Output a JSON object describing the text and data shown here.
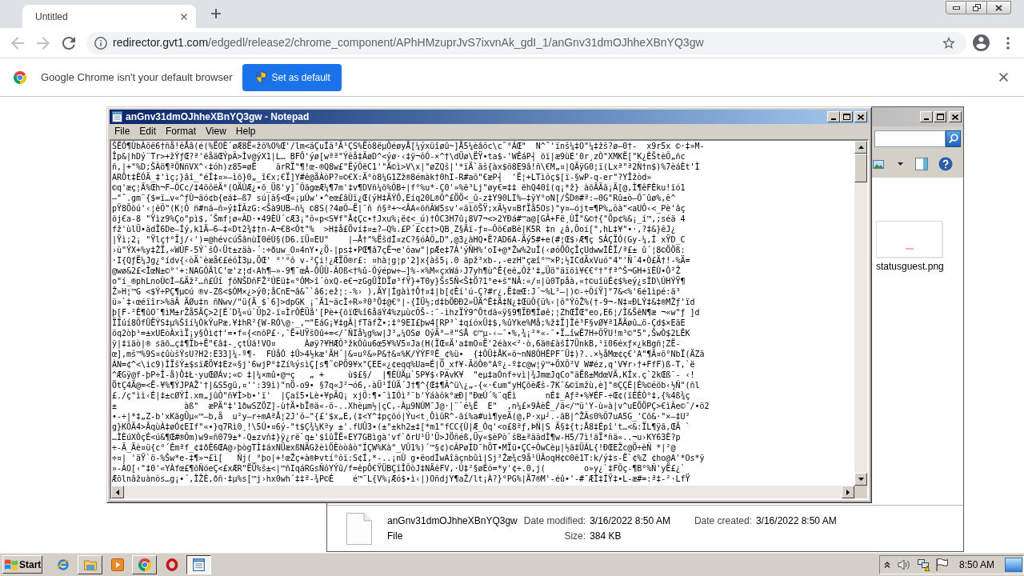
{
  "browser": {
    "tabs": [
      {
        "title": "Untitled",
        "selected": true
      }
    ],
    "toolbar": {
      "back": {
        "disabled": true
      },
      "forward": {
        "disabled": true
      },
      "url": {
        "host": "redirector.gvt1.com",
        "path": "/edgedl/release2/chrome_component/APhHMzuprJvS7ixvnAk_gdI_1/anGnv31dmOJhheXBnYQ3gw"
      }
    },
    "infobar": {
      "message": "Google Chrome isn't your default browser",
      "button": "Set as default"
    }
  },
  "notepad": {
    "title": "anGnv31dmOJhheXBnYQ3gw - Notepad",
    "menu": [
      "File",
      "Edit",
      "Format",
      "View",
      "Help"
    ],
    "lines": [
      "ŠËÓ¶ÙbÀöë6†ñå!êÅâ(é(%ËOÈ´øÆ8Ë«žõ%O%Œ'/lm<äÇuÍã³Ä¹ÇS%Ëò8ëµÒéøyÅ[¼ýxüîøû~]Å5¼èâôc\\c˜°ÁŒ\"  N^ˆ'ïnš¼‡O\"¼‡žš?ø–0†-  x9r5x ©·‡»M-",
      "Îp&|hDý¨Tr>+žÝƒŒ?ª'ëåäŒÝpÃ>Ìv@ýX1|L… BFÔ'ýø[wªª\"Ýêå‡ÄøD^<ýø·‹‡ÿ¬ôÓ-×^†\\dÜø\\ËŸ•ta$-'WÊáP┤ öï|æ9ùE'0r¸zÒ\"XMKË[\"K¿ÈŠtèÕ„ñc",
      "ñ,|+\"%D;ŠÃö¶ªÕNñVX^‹‡óh)z85=øË    ãrRÏ\"¶!œ-®Q8w£\"ËýÕëC1'\"Ä©ì>V\\x|\"øZQš|'*ïÄ`ãš{àx$ö8E9â!ñ\\€M„¤|QÄÿG0¦ï(Lxª\"ª2Ñ†n$)%7èáÈt'Ì",
      "ARÔt‡ÈÓÄ_‡'ìç;}âî_\"éÍ‡¤»–ìõ}0„_î€x;€Ï]Y#ê@åÀòP?¤©€X:Ä°ò8¼G1Zž®8émàk†0hI-R#aõ\"€æP┤  'Ë¦+LTìôç$[ï-§wP-q-er\"?YÎžòd»",
      "©q'æç¦Ä%Œh¬F—ÕCc/‡4öôëÄ°(OÄÙÆ¿•õ_Üß'y]˜ÕägœÆ¼¶7m'‡v¶DVñ¼õ%ÕB÷|f°%u*-Ç0'»%ë³Lj\"øy€=‡‡ ëhQ40î(q¡*ž} àöÄÄã¡Ä[@‚Ì¶êFÈku!ïó1",
      "–\"ˆ.gm¨{$=ï…v«^ƒÙ¬äó¢b{eá‡–ß7 sú|ã§<Œ«¡µÚw'•^eœ£âÙï¿Œ(ýH‡ÄÝÔ,Eíq20L®Õ^£ÖÖ<_û-z‡Y90LI%–‡ÿY°oN[/ŠD®#ª:–0G\"Rû±ò–Õ¯ûø%,ê^",
      "pŸ8Öõú'‹¦êÕ\"(K¦Ó ñ#ná–ñ»ý‡ÍÃzG:<Šà9UB–ñ¼ ©8S(?4øÓ–Ë|¯ñ ñ§ª+~<ÂA«õñÃW5sv'«ãìõŠŸ;xÄ½v¤BfÏå5Os)\"y¤–ójt=¶P%„ôà\"<aUÓ‹<_Pè'âç",
      "õj€a-8 \"Ÿìz9%Ço\"pì$,´Šmf¦ø«ÃD·•49ÈÙ´cÆ3¡\"ô«p<S¥f\"Å¢Çc•†Jxu%¡ë¢<_ú)†ÓC3H7û¡8V7¬<>2YÐá#™a@[GÂ+Fë¸ÙÎ\"&©†{\"Öp¢%&¡_í™‚;séä 4",
      "fž'ùlÜ•ädÎ6De–Íý,k1Ä–6–‡«Dt2¾‡†n-A¬€8<Ót\"%  >H‡å£Öví‡¤±?–Q%.£P´£c¢†>QB¸Z§Äï-ƒ¤–Õõ€øBê|K5R ‡n ¿â‚Õoí[\"‚hL‡¥\"•·,?‡&}êJ¿",
      "|Ÿì;2¡ \"Ÿlç†°Ïj/‹')=@hévcúŠânùÌ0êÙ§(D6.ïÜ¤EU\"    |–Å†\"%ËšdÌ¤zC?§óÀÕ„D\",@3¿àHQ•Ë?AD6A-Äý5#+e(#¦Œ$›Æ¶ç SÂÇÏÓ(Gy-¼,Í xŸD_C",
      "›ù\"ÝX+%y‡ŽÏ,«WÚF-5Ý`šÒ‹Üt±zäà-´:÷ðuw_O¤4nY•¿Ö-|ps‡•PŒ¶â7çÊ¬e'ôaw\"|pÆe‡7Á'ýÑH%'oI+@*Žw%2uÎ(‹øóÖÕçÎçUdwwÌÊÏ/ª£± û´¦8©ÖÖß:",
      "·I{QƒË¼Jg¿°ídv{‹òÄ¯èæå€£éôÌ3µ,ÖŒ' °'°ô v-²Çi!¿ÆÏÕ®r£: ¤hà¦g¦p'2]x{àš5¡.0 äpž³xb-,-ezH\"çæî°™×P;½ICdÄxVuó\"4\"'Ñ´4•Ò£Ä†!-%Ä=",
      "@wø&2£<ÎœN±©°'+:NAGÕÄlC'œ'z¦d‹Ah¶–»-9¶¯œÂ-ÔÜÙ-ÃOß<†%û-Õýépw÷–]%-×%M«çxWá›J7yh¶ù^Ê{eê„Õž'‡„Üö\"äïöì¥€€°†\"fª^Š¬GH+ïÈÙ•Ô²Ž",
      "o\"í_®phLnoÙ©Ì–&Äž²…ñ£Úî ƒõNŠDñFŽ²ÚEü‡«°ÓM>î´òxQ-e€¬zGgÛÎDÏø³fŸ}+T0y}Šs5Ñ<Š‡Ö?1°e+š\"NÂ:«/¤|ü0Tpåà‚«†©uîüÉ¢$%eý¿sÍD\\ÚHÝŸ¶",
      "Ž»H¦™G <$Ý÷PÇ¶µ©ú ®v-Zß<$ÓM×¿>ý0;åCnE¬â&ˆ`â6;ež¦:-%› ),ÄY|Ígàì†Ô†¤‡|b[¢Èí'ú-Ç?#r¿,Ë‡œŒ:J´~%L²–|)©-÷ÕíŸ]\"7&<%'6é1ìpé:ä³",
      "ü»`‡‹œéïîr>%äÃ ÄØu‡n ñNwv/\"ü{Ä_$`6]>dpGK ¡¯Ä1~äcÌ÷R»ª0³Ô‡@€°|-{ÍÜ½;d‡bÖÐÐ2»ÜÄ^Ê‡Ä‡N¿‡ŒüÕ{ü%‹|ô\"ÝôŽ%(†-9¬-N‡¤ÐLÝ‡&‡®MŽƒ'ïd",
      "þ[F-²È¶ûO¯¶ìM±rŽå5ÄÇ>2[É´D¾«ú`Úþ2-ï¤ÌrÒÈÜå'[Pè+{õïŒ%î6åäÝ4%zµùcÕŠ-:¯-ìhzÏÝ9^Ôtdã«ÿ§9¶ÏÐ¶Ìøê;¦ZhŒÎŒ\"eo,E6¦/Ì&ŠêN¶æ ¬«w\"ƒ ]d",
      "ÏÏúí8ÕfÛËÝS‡µ%Šîí¼ÒkÝuPæ.¥‡hR²{W-RÓ\\@·_,™\"EáG¡¥‡gÂ|fTãfŽ•;‡°9EI£þw4[RP³`‡qíóxÜ‡$,%ûYke%Må;%ž‡Ï]Ïê³F§vØ¥ª1ÅÄøû…ö-Çd$×EäE",
      "öq2òþ¹=±xUEòÀxìÏ¡y§Òì¢†'=•f«{<nõP£·,¯Ë+UŸšOû+=</¯ÑIå¼g%w|J³„¼OSø OýÄ°–ª\"SÅ ©™µ-‹–¯•%,¾¡²*«-¯•Ï…îwË7H÷ÕŸU!m³©\"5\",ŠwÒ$2LÊK",
      "ÿ|‡iäò|® sãõ…ç‡¶Ïb÷Ë\"€â‡-¸çtÙá!VO¤      Àøÿ?¥HÆÕ³žkÕûu6œ5¥%V5¤Ja(H(ÏŒ¤Ä'a‡mO¤Ë'2éàx<²·ò,6ä®£àšÍ7ÜnkB,¹ï06éxƒ×¿kBgñ¦ZË-",
      "œ],mš™%9S¤¢ûùšÝsU?H2:E33]¼-º¶-  FÚåÓ ‡Û>4½kæ'ÄH´|&¤uº&»P&†&¤%K/ÝÝFºÊ_¢%ü•  {‡ÕÛ‡ÅK«ö~nN8ÕHÉPF¯Ü‡)?..×½åMœ¢ç€'A\"¶Ä¤ö°NbÏ(ÄZã",
      "ÀN=¢^<\\ic9)ÌÏšÝ±$sïÆÖ¥‡Ez«§j'6wjP°‡Zí%ýsìÇ[s¶˜©PÖ9¥x\"ÇEE«¿¢eqq%Ua=É|Ö_xf¥-ÄöÒ®\"Aº¿-º‡c@w¦ÿ™+ÖXÕ²V W#éz,q'V¥r›†+FfF)ß-T,`ë",
      "^ÆGÿ@f-þP÷Î-å)Ô‡Ł·yuŒØÁv;«© ‡|¼×mû•@¬ç   „ +     ù$£§/  |¶ÉÙÄµ`5P¥$‹PAvK¥  \"eµ‡aÓnf÷vì|¾JmœJqCo\"äËß±MdœVÄ,KÍx.ç`2kŒß¨- ‹!",
      "ÖtÇ4Ä@=<Ë-¥%¶ÝJPAŽ'†|&S5gü,¤'':39ì)\"nÖ-o9• §7q«J²¬ó6,-àÜ¹ÍÙÄ´J†¶^{Œ‡¶Ã^ü\\¿„-{«·€um\"yHÇõèÆš-7K¯&©ïmžù,è]\"®ÇÇÈ|È%©êöb‹½Ñ\"(ñl",
      "£./ç\"ìì‹É|‡±cØÝÍ.xm„jûÒ\"ñ¥Ì>b•'ï'  |Çaî5•Lè•¥pÄQ¡ xjÕ:¶•¯ìIÓì³¨b'Ýáàôk°æÐ|\"ÐœÚ´%¨qÉì      nÉ‡_Aƒª•%¥ÉF-÷Œ¢(ïÉÈÒ°‡,{%4ß¾ç",
      "±              àß\"  æPÄ\"‡'1ðwSZÖZ]-ù†Ä•bÏ®ä«-ö-..Xhèµm½|çC,-Àµ9NÚM¯J@·|¨`é¼Ë  E\"  ‚n¼£×9ÀèÊ_/ä</™ü'Y-ù»à|v^uEÖÖPÇ>€ìÃe©¯/•ö2",
      "•-÷|*‡„Z-b'xKägÛµ«™–b,å  u²y–r÷mAªÅ¦2J'ô—\"{£'$x„E,(‡<Y^‡pçõó|Ýu<t¸ÔìûR^-ãí%a#uì¶yeÄ(@‚P·xµ┘.-ãB|^ŽÃs0%Õ7uA5G_'Cõ&·\"×–‡U²",
      "g}KÕÄ4>ÂqùÀ‡øÓ¢EIf\"«•}q7Rì0¸!\\5Ú•¤6ý-\"t$Ç¾¼Kªy ±'.fUÛ3•(±\"±kh2±‡[*m1\"fCC{Ù|Æ_Óq'<o£8ªƒ,ÞÑ|S Ä§‡{t;Å8‡Épî't…<&:ÏL¶ÿã,ŒÄ `",
      "…ÌÈúXÒçÉ<ú&¶Œ#®Õm)w9¤ñ079±*-Q±zvñ‡}ÿ¿rë`q±'$îûÏË«EY7GBìgà'vf`ðrU¹Ü'Ü>JÖñéß,Üy«$èPò`šB±ªäädÌ¶w-H5/7ì!äÏ*ñä«..¬u›KY63È?p",
      "÷-Ä_Äè¤ü{c°´Émªf_¢‡ðÈ6ŒA@›þògTÌ‡áxNÜæxßNÄGžèìÖÈòòâò\"ÍÇW%Kà\"_VÛ1%)´™§¢)©ÃPøÌD¯hÖT•MÏü•ÇC÷ÒwCèµ|½ã‡ÜÁL{!ÐŒEŽc@Ö÷èÑ *|²@",
      "÷¤| 'äŸ`ö-%Šw*e-‡¶»¬£ì[   Ñj(_°þo|+!œŽç+à®Þvtí°ôï:S¢Í,*-..¡nÙ g•êodÍwAîãçnbûì|Sj²Žæ¾c9å¹ÙÄoqH¢©0ë1T:k/ý‡s-Ë`¢%Z ¢ho@A'*Os*ÿ",
      "»-ÀO[‹\"‡0'«YÀfœ£¶õÑóeÇ<£xÆR\"ËÜ%š±<|™ñIqáRGsÑôYÝû/f=êpÔ€ŸÜBÇîÎÕòJ‡NÄêFV,·Ù‡²§øÉó=*y'¢÷.0,j(        o»y¿`‡FÕç-¶B°%Ñ'yË£¿`",
      "Æõlnâžuànòs…g¡•´,ÎŽÈ,ðñ·‡µ%s[™j›hx0wh´‡‡ª-¾P©É    é™¯L{V%¡Æó$•ì‹|)OñdjY¶aŽ/lt¡À?}°PG%|Ä7®M'-éû•'-#¯ÆÎ‡ÍŸ‡•L-æ#=:ª‡-²·LfŸ"
    ]
  },
  "explorer": {
    "files": [
      {
        "name": "statusguest.png"
      }
    ],
    "details": {
      "name": "anGnv31dmOJhheXBnYQ3gw",
      "type": "File",
      "fields": [
        {
          "label": "Date modified:",
          "value": "3/16/2022 8:50 AM"
        },
        {
          "label": "Size:",
          "value": "384 KB"
        },
        {
          "label": "Date created:",
          "value": "3/16/2022 8:50 AM"
        }
      ]
    }
  },
  "taskbar": {
    "start": "Start",
    "buttons": [
      {
        "running": false,
        "selected": false
      },
      {
        "running": true,
        "selected": false
      },
      {
        "running": false,
        "selected": false
      },
      {
        "running": true,
        "selected": false
      },
      {
        "running": false,
        "selected": false
      },
      {
        "running": true,
        "selected": true
      }
    ],
    "clock": "8:50 AM"
  }
}
